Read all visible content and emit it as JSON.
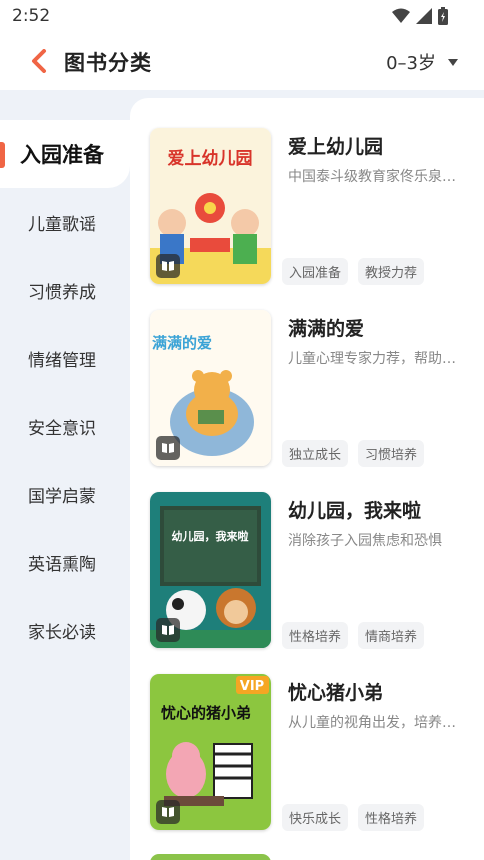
{
  "status_bar": {
    "time": "2:52"
  },
  "header": {
    "title": "图书分类",
    "age_filter": "0–3岁"
  },
  "sidebar": {
    "items": [
      {
        "label": "入园准备",
        "active": true
      },
      {
        "label": "儿童歌谣"
      },
      {
        "label": "习惯养成"
      },
      {
        "label": "情绪管理"
      },
      {
        "label": "安全意识"
      },
      {
        "label": "国学启蒙"
      },
      {
        "label": "英语熏陶"
      },
      {
        "label": "家长必读"
      }
    ]
  },
  "books": [
    {
      "title": "爱上幼儿园",
      "description": "中国泰斗级教育家佟乐泉教授力荐",
      "tags": [
        "入园准备",
        "教授力荐"
      ],
      "cover_text": "爱上幼儿园"
    },
    {
      "title": "满满的爱",
      "description": "儿童心理专家力荐，帮助孩子独立成长",
      "tags": [
        "独立成长",
        "习惯培养"
      ],
      "cover_text": "满满的爱"
    },
    {
      "title": "幼儿园，我来啦",
      "description": "消除孩子入园焦虑和恐惧",
      "tags": [
        "性格培养",
        "情商培养"
      ],
      "cover_text": "幼儿园，我来啦"
    },
    {
      "title": "忧心猪小弟",
      "description": "从儿童的视角出发，培养乐观性格",
      "tags": [
        "快乐成长",
        "性格培养"
      ],
      "cover_text": "忧心的猪小弟",
      "cover_badge": "VIP"
    }
  ],
  "colors": {
    "accent": "#f06545",
    "background": "#eef2f8"
  },
  "icons": {
    "back": "chevron-left-icon",
    "dropdown": "caret-down-icon",
    "read": "book-open-icon"
  }
}
